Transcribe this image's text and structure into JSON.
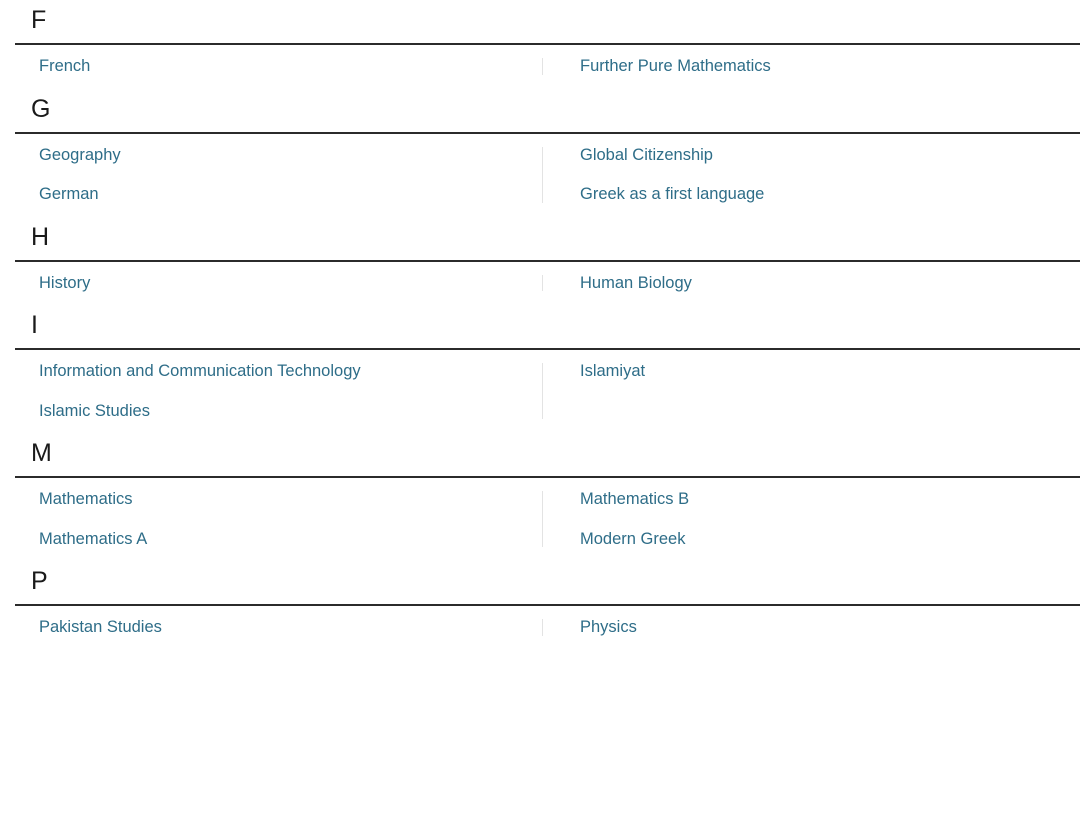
{
  "page": {
    "type": "subject-index",
    "link_color": "#2e6d88",
    "heading_color": "#1a1a1a",
    "rule_color": "#2b2b2b",
    "divider_color": "#e3e3e3",
    "background": "#ffffff"
  },
  "sections": [
    {
      "letter": "F",
      "left": [
        "French"
      ],
      "right": [
        "Further Pure Mathematics"
      ]
    },
    {
      "letter": "G",
      "left": [
        "Geography",
        "German"
      ],
      "right": [
        "Global Citizenship",
        "Greek as a first language"
      ]
    },
    {
      "letter": "H",
      "left": [
        "History"
      ],
      "right": [
        "Human Biology"
      ]
    },
    {
      "letter": "I",
      "left": [
        "Information and Communication Technology",
        "Islamic Studies"
      ],
      "right": [
        "Islamiyat"
      ]
    },
    {
      "letter": "M",
      "left": [
        "Mathematics",
        "Mathematics A"
      ],
      "right": [
        "Mathematics B",
        "Modern Greek"
      ]
    },
    {
      "letter": "P",
      "left": [
        "Pakistan Studies"
      ],
      "right": [
        "Physics"
      ]
    }
  ]
}
